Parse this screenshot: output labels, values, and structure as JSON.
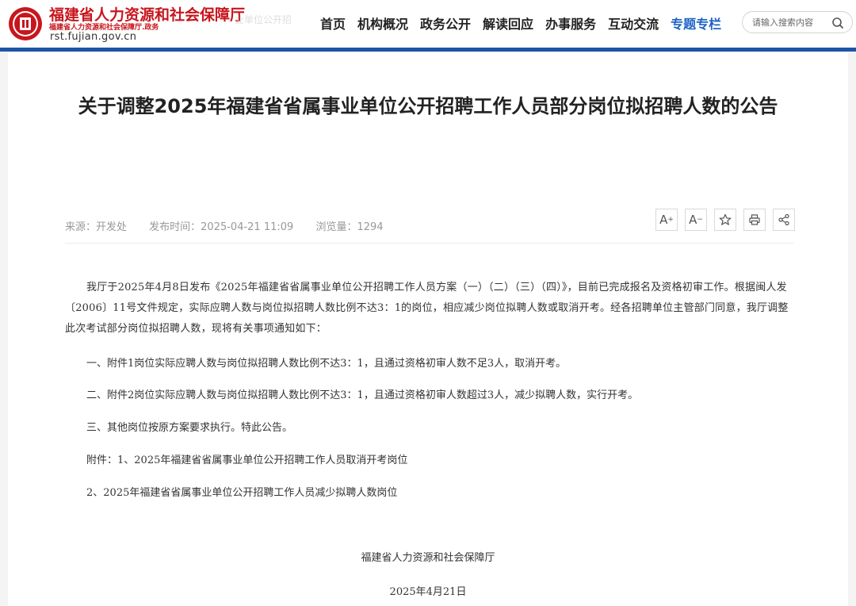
{
  "header": {
    "site_name": "福建省人力资源和社会保障厅",
    "site_sub": "福建省人力资源和社会保障厅.政务",
    "site_domain": "rst.fujian.gov.cn",
    "ghost_text": "业单位公开招",
    "nav": [
      "首页",
      "机构概况",
      "政务公开",
      "解读回应",
      "办事服务",
      "互动交流",
      "专题专栏"
    ],
    "search_placeholder": "请输入搜索内容",
    "brand_color": "#c8161d",
    "accent_color": "#1f55a8"
  },
  "article": {
    "title": "关于调整2025年福建省省属事业单位公开招聘工作人员部分岗位拟招聘人数的公告",
    "source": "来源：开发处",
    "publish_time": "发布时间：2025-04-21 11:09",
    "views": "浏览量：1294",
    "tools": {
      "font_increase": "A",
      "font_decrease": "A"
    },
    "intro": "我厅于2025年4月8日发布《2025年福建省省属事业单位公开招聘工作人员方案（一）（二）（三）（四）》，目前已完成报名及资格初审工作。根据闽人发〔2006〕11号文件规定，实际应聘人数与岗位拟招聘人数比例不达3：1的岗位，相应减少岗位拟聘人数或取消开考。经各招聘单位主管部门同意，我厅调整此次考试部分岗位拟招聘人数，现将有关事项通知如下：",
    "items": [
      "一、附件1岗位实际应聘人数与岗位拟招聘人数比例不达3：1，且通过资格初审人数不足3人，取消开考。",
      "二、附件2岗位实际应聘人数与岗位拟招聘人数比例不达3：1，且通过资格初审人数超过3人，减少拟聘人数，实行开考。",
      "三、其他岗位按原方案要求执行。特此公告。",
      "附件：1、2025年福建省省属事业单位公开招聘工作人员取消开考岗位",
      "2、2025年福建省省属事业单位公开招聘工作人员减少拟聘人数岗位"
    ],
    "signature_org": "福建省人力资源和社会保障厅",
    "signature_date": "2025年4月21日"
  }
}
